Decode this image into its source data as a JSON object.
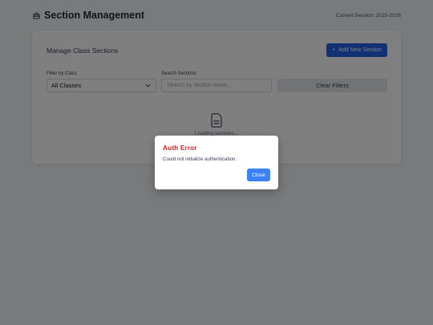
{
  "header": {
    "title": "Section Management",
    "title_icon": "building-icon",
    "session": "Current Session: 2025-2026"
  },
  "card": {
    "title": "Manage Class Sections",
    "add_button": "Add New Section",
    "add_icon": "plus-icon",
    "filter_label": "Filter by Class",
    "filter_value": "All Classes",
    "search_label": "Search Sections",
    "search_placeholder": "Search by section name...",
    "clear_button": "Clear Filters",
    "loading_icon": "document-icon",
    "loading_text": "Loading sections..."
  },
  "modal": {
    "title": "Auth Error",
    "message": "Could not initialize authentication.",
    "close_button": "Close"
  },
  "colors": {
    "primary": "#2563eb",
    "error": "#dc2626",
    "close_button": "#3b82f6"
  }
}
